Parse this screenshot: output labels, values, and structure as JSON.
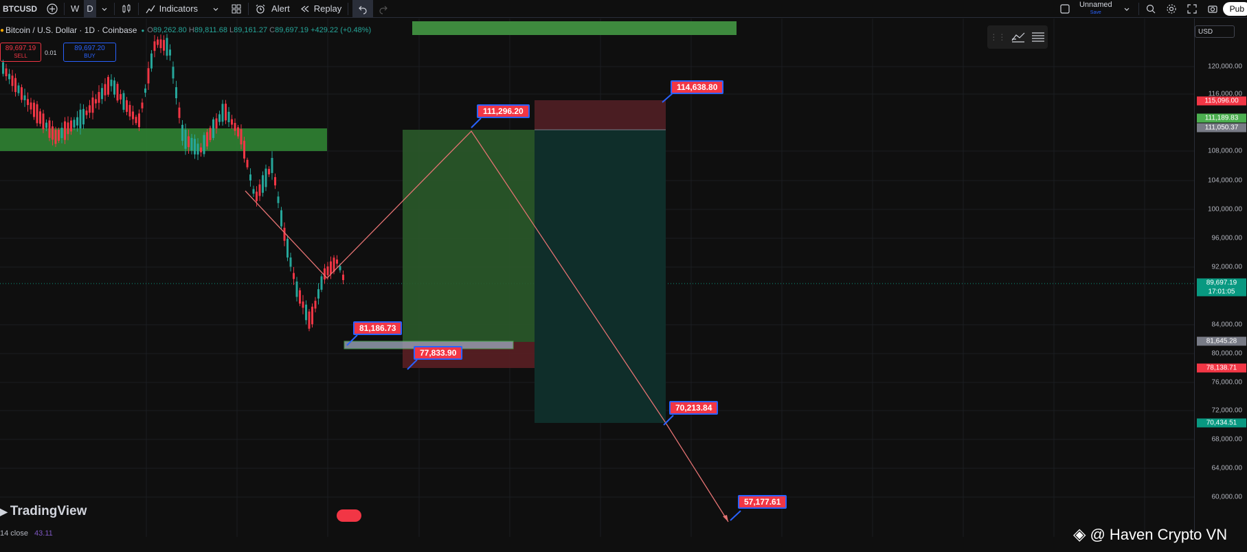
{
  "toolbar": {
    "symbol": "BTCUSD",
    "interval_w": "W",
    "interval_d": "D",
    "indicators_label": "Indicators",
    "alert_label": "Alert",
    "replay_label": "Replay",
    "layout_name": "Unnamed",
    "layout_sub": "Save",
    "publish_label": "Pub"
  },
  "legend": {
    "title": "Bitcoin / U.S. Dollar · 1D · Coinbase",
    "open": "89,262.80",
    "high": "89,811.68",
    "low": "89,161.27",
    "close": "89,697.19",
    "change": "+429.22 (+0.48%)",
    "o": "O",
    "h": "H",
    "l": "L",
    "c": "C"
  },
  "trade": {
    "sell_price": "89,697.19",
    "sell_label": "SELL",
    "spread": "0.01",
    "buy_price": "89,697.20",
    "buy_label": "BUY"
  },
  "currency": "USD",
  "price_axis": {
    "ticks": [
      "120,000.00",
      "116,000.00",
      "108,000.00",
      "104,000.00",
      "100,000.00",
      "96,000.00",
      "92,000.00",
      "84,000.00",
      "80,000.00",
      "76,000.00",
      "72,000.00",
      "68,000.00",
      "64,000.00",
      "60,000.00"
    ],
    "labels": [
      {
        "text": "115,096.00",
        "color": "#f23645"
      },
      {
        "text": "111,189.83",
        "color": "#4caf50"
      },
      {
        "text": "111,050.37",
        "color": "#787b86"
      },
      {
        "text": "89,697.19",
        "color": "#089981"
      },
      {
        "text": "17:01:05",
        "color": "#089981"
      },
      {
        "text": "81,645.28",
        "color": "#787b86"
      },
      {
        "text": "78,138.71",
        "color": "#f23645"
      },
      {
        "text": "70,434.51",
        "color": "#089981"
      }
    ]
  },
  "callouts": [
    "114,638.80",
    "111,296.20",
    "81,186.73",
    "77,833.90",
    "70,213.84",
    "57,177.61"
  ],
  "branding": {
    "logo": "TradingView",
    "rsi_label": "14 close",
    "rsi_value": "43.11",
    "watermark": "@ Haven Crypto VN"
  },
  "colors": {
    "up": "#26a69a",
    "down": "#f23645",
    "accent": "#2962ff"
  }
}
